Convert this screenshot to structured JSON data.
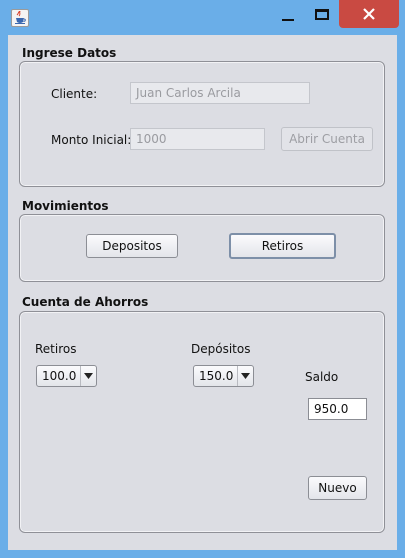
{
  "window": {
    "icons": {
      "app": "java-app-icon",
      "minimize": "minimize-icon",
      "maximize": "maximize-icon",
      "close": "close-icon"
    },
    "colors": {
      "titlebar": "#6aaee8",
      "close_button": "#c94a42",
      "client_bg": "#dcdde3"
    }
  },
  "ingreso": {
    "title": "Ingrese Datos",
    "cliente_label": "Cliente:",
    "cliente_value": "Juan Carlos Arcila",
    "monto_label": "Monto Inicial:",
    "monto_value": "1000",
    "abrir_button": "Abrir Cuenta"
  },
  "movimientos": {
    "title": "Movimientos",
    "depositos_button": "Depositos",
    "retiros_button": "Retiros"
  },
  "cuenta": {
    "title": "Cuenta de Ahorros",
    "retiros_label": "Retiros",
    "retiros_selected": "100.0",
    "depositos_label": "Depósitos",
    "depositos_selected": "150.0",
    "saldo_label": "Saldo",
    "saldo_value": "950.0",
    "nuevo_button": "Nuevo"
  }
}
